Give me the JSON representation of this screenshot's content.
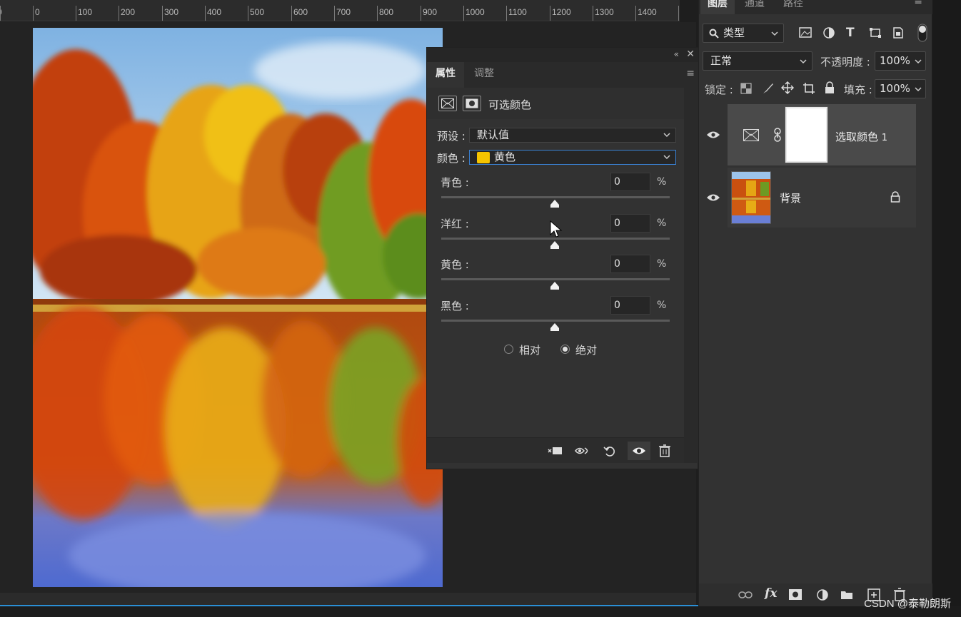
{
  "ruler": {
    "labels": [
      "0",
      "100",
      "200",
      "300",
      "400",
      "500",
      "600",
      "700",
      "800",
      "900",
      "1000",
      "1100",
      "1200",
      "1300",
      "1400"
    ],
    "partial_left": "0"
  },
  "properties": {
    "tabs": [
      "属性",
      "调整"
    ],
    "header_title": "可选颜色",
    "preset_label": "预设 :",
    "preset_value": "默认值",
    "color_label": "颜色 :",
    "color_value": "黄色",
    "color_swatch": "#f5c400",
    "sliders": [
      {
        "label": "青色 :",
        "value": "0",
        "unit": "%"
      },
      {
        "label": "洋红 :",
        "value": "0",
        "unit": "%"
      },
      {
        "label": "黄色 :",
        "value": "0",
        "unit": "%"
      },
      {
        "label": "黑色 :",
        "value": "0",
        "unit": "%"
      }
    ],
    "radio_relative": "相对",
    "radio_absolute": "绝对",
    "radio_selected": "绝对"
  },
  "layers": {
    "tabs": [
      "图层",
      "通道",
      "路径"
    ],
    "filter_label": "类型",
    "blend_mode": "正常",
    "opacity_label": "不透明度 :",
    "opacity_value": "100%",
    "lock_label": "锁定 :",
    "fill_label": "填充 :",
    "fill_value": "100%",
    "items": [
      {
        "name": "选取颜色",
        "suffix": "1"
      },
      {
        "name": "背景"
      }
    ]
  },
  "watermark": "CSDN @泰勒朗斯",
  "colors": {
    "accent": "#2a8fd6",
    "panel": "#323232",
    "selected_layer": "#4a4a4a"
  }
}
